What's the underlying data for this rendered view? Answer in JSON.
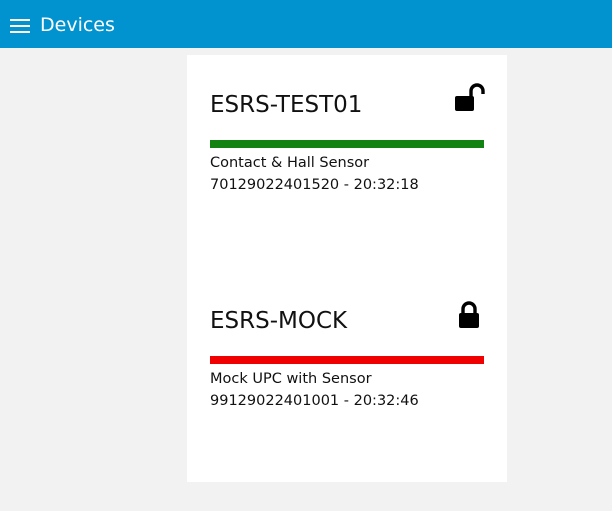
{
  "header": {
    "title": "Devices",
    "menu_icon": "hamburger-menu-icon",
    "background_color": "#0093cf"
  },
  "devices": [
    {
      "name": "ESRS-TEST01",
      "lock_state": "unlocked",
      "lock_icon": "lock-open-icon",
      "status_color": "#128212",
      "type": "Contact & Hall Sensor",
      "serial_time": "70129022401520 - 20:32:18"
    },
    {
      "name": "ESRS-MOCK",
      "lock_state": "locked",
      "lock_icon": "lock-closed-icon",
      "status_color": "#f00000",
      "type": "Mock UPC with Sensor",
      "serial_time": "99129022401001 - 20:32:46"
    }
  ]
}
